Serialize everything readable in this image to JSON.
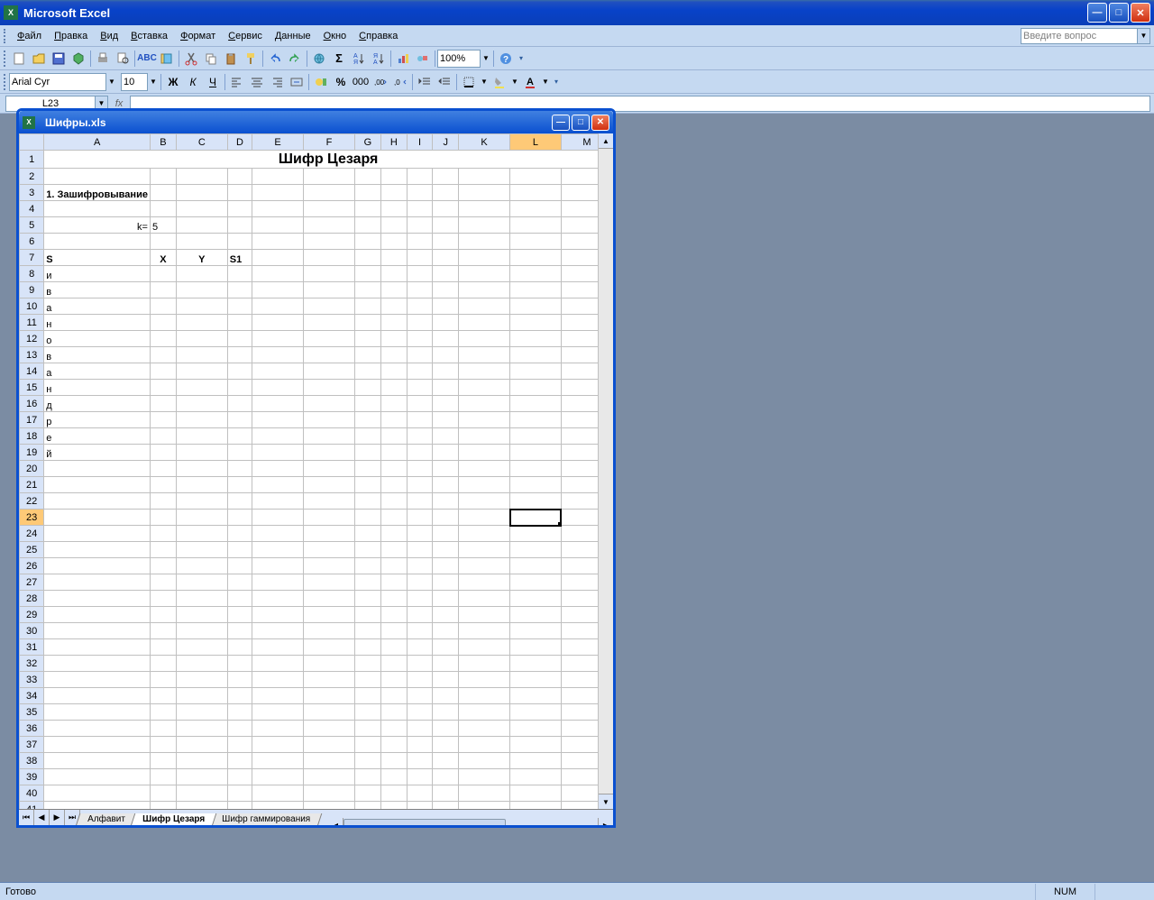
{
  "app_title": "Microsoft Excel",
  "menu": [
    "Файл",
    "Правка",
    "Вид",
    "Вставка",
    "Формат",
    "Сервис",
    "Данные",
    "Окно",
    "Справка"
  ],
  "help_placeholder": "Введите вопрос",
  "font_name": "Arial Cyr",
  "font_size": "10",
  "zoom": "100%",
  "namebox": "L23",
  "formula": "",
  "workbook_title": "Шифры.xls",
  "columns": [
    "A",
    "B",
    "C",
    "D",
    "E",
    "F",
    "G",
    "H",
    "I",
    "J",
    "K",
    "L",
    "M"
  ],
  "active_col": "L",
  "active_row": 23,
  "row_count": 41,
  "cells": {
    "1": {
      "title": "Шифр Цезаря"
    },
    "3": {
      "A": "1. Зашифровывание",
      "bold": true
    },
    "5": {
      "A": "k=",
      "B": "5"
    },
    "7": {
      "A": "S",
      "B": "X",
      "C": "Y",
      "D": "S1",
      "bold": true
    },
    "8": {
      "A": "и"
    },
    "9": {
      "A": "в"
    },
    "10": {
      "A": "а"
    },
    "11": {
      "A": "н"
    },
    "12": {
      "A": "о"
    },
    "13": {
      "A": "в"
    },
    "14": {
      "A": "а"
    },
    "15": {
      "A": "н"
    },
    "16": {
      "A": "д"
    },
    "17": {
      "A": "р"
    },
    "18": {
      "A": "е"
    },
    "19": {
      "A": "й"
    }
  },
  "sheet_tabs": [
    "Алфавит",
    "Шифр Цезаря",
    "Шифр гаммирования"
  ],
  "active_tab": 1,
  "status": "Готово",
  "status_num": "NUM"
}
